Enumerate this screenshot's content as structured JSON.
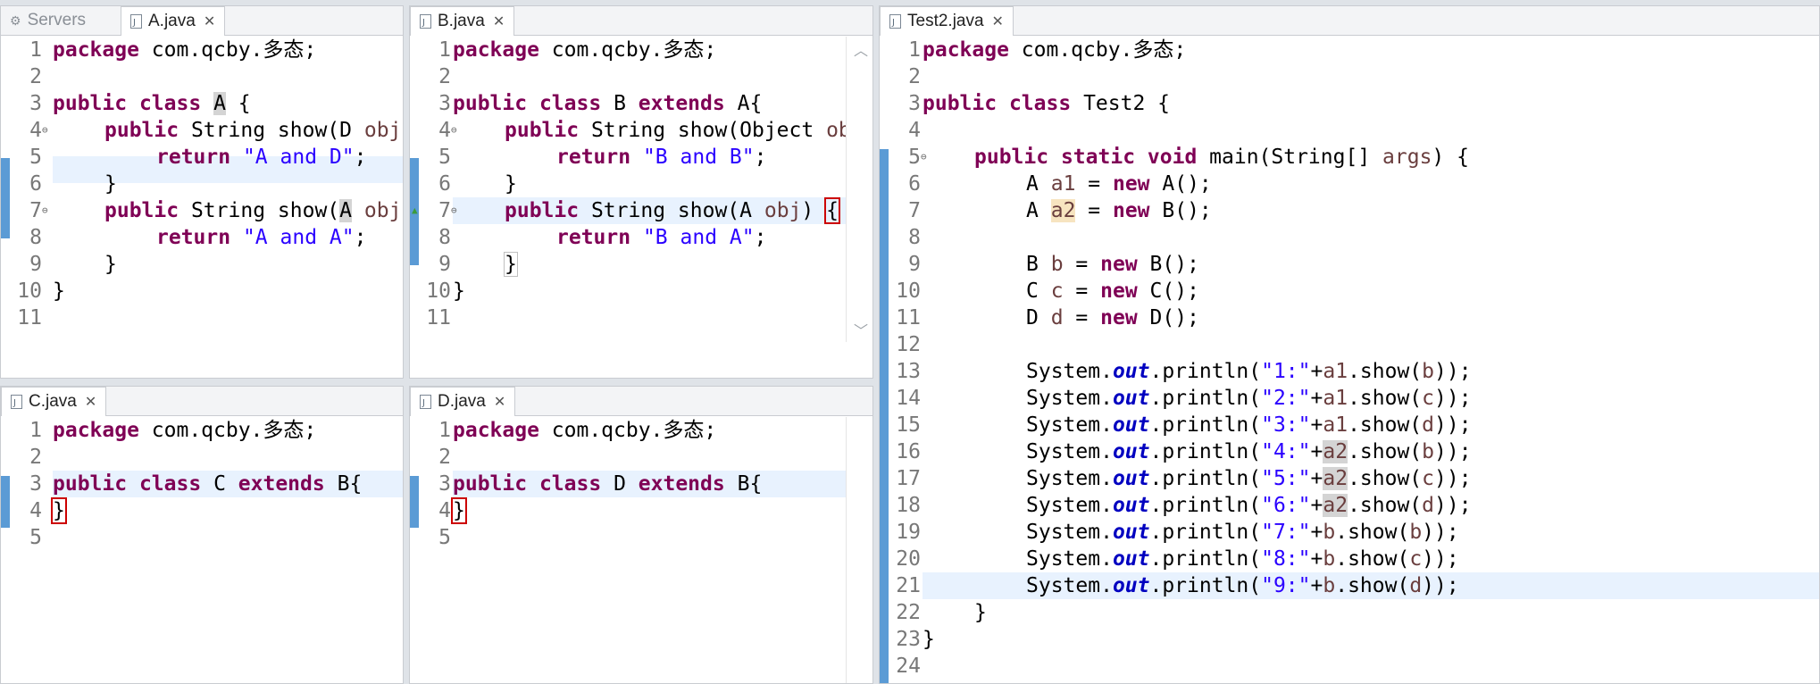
{
  "panes": {
    "a": {
      "tabs": [
        {
          "label": "Servers",
          "active": false
        },
        {
          "label": "A.java",
          "active": true
        }
      ],
      "lines": [
        [
          "1",
          [
            [
              "kw",
              "package"
            ],
            [
              "",
              "  com.qcby.多态;"
            ]
          ]
        ],
        [
          "2",
          []
        ],
        [
          "3",
          [
            [
              "kw",
              "public"
            ],
            [
              "",
              ""
            ],
            [
              "kw",
              " class"
            ],
            [
              "",
              ""
            ]
          ]
        ],
        [
          "4",
          []
        ],
        [
          "5",
          []
        ],
        [
          "6",
          []
        ],
        [
          "7",
          []
        ],
        [
          "8",
          []
        ],
        [
          "9",
          []
        ],
        [
          "10",
          []
        ],
        [
          "11",
          []
        ]
      ]
    },
    "b": {
      "tabs": [
        {
          "label": "B.java",
          "active": true
        }
      ]
    },
    "c": {
      "tabs": [
        {
          "label": "C.java",
          "active": true
        }
      ]
    },
    "d": {
      "tabs": [
        {
          "label": "D.java",
          "active": true
        }
      ]
    },
    "t": {
      "tabs": [
        {
          "label": "Test2.java",
          "active": true
        }
      ]
    }
  },
  "text": {
    "pkg": "package",
    "pkgname": " com.qcby.多态;",
    "public": "public",
    "static": "static",
    "void": "void",
    "class": "class",
    "extends": "extends",
    "return": "return",
    "new": "new",
    "String": "String",
    "nameA": "A",
    "nameB": "B",
    "nameC": "C",
    "nameD": "D",
    "nameTest2": "Test2",
    "showD": "show(D ",
    "showA": "show(",
    "showObj": "show(Object ",
    "obj": "obj",
    "strAD": "\"A and D\"",
    "strAA": "\"A and A\"",
    "strBB": "\"B and B\"",
    "strBA": "\"B and A\"",
    "main": "main(String[] ",
    "args": "args",
    "a1": "a1",
    "a2": "a2",
    "b": "b",
    "c": "c",
    "d": "d",
    "sysout": "System.",
    "out": "out",
    "println": ".println(",
    "s1": "\"1:\"",
    "s2": "\"2:\"",
    "s3": "\"3:\"",
    "s4": "\"4:\"",
    "s5": "\"5:\"",
    "s6": "\"6:\"",
    "s7": "\"7:\"",
    "s8": "\"8:\"",
    "s9": "\"9:\""
  },
  "colors": {
    "keyword": "#7f0055",
    "string": "#2a00ff",
    "variable": "#6a3e3e",
    "field": "#0000c0",
    "linehighlight": "#e8f2fe"
  }
}
